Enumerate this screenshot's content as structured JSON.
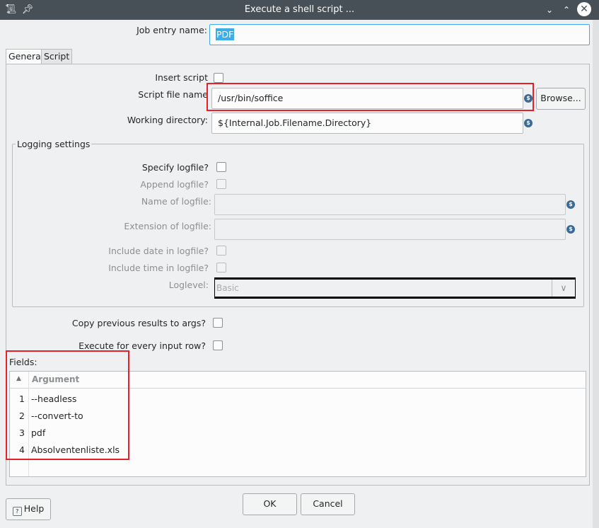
{
  "window": {
    "title": "Execute a shell script ..."
  },
  "job_entry": {
    "label": "Job entry name:",
    "value": "PDF"
  },
  "tabs": [
    {
      "label": "General",
      "active": true
    },
    {
      "label": "Script",
      "active": false
    }
  ],
  "general": {
    "insert_script_label": "Insert script",
    "script_file_label": "Script file name",
    "script_file_value": "/usr/bin/soffice",
    "browse_label": "Browse...",
    "working_dir_label": "Working directory:",
    "working_dir_value": "${Internal.Job.Filename.Directory}"
  },
  "logging": {
    "group_title": "Logging settings",
    "specify_logfile_label": "Specify logfile?",
    "append_logfile_label": "Append logfile?",
    "name_of_logfile_label": "Name of logfile:",
    "extension_label": "Extension of logfile:",
    "include_date_label": "Include date in logfile?",
    "include_time_label": "Include time in logfile?",
    "loglevel_label": "Loglevel:",
    "loglevel_value": "Basic"
  },
  "options": {
    "copy_previous_label": "Copy previous results to args?",
    "execute_every_row_label": "Execute for every input row?"
  },
  "fields": {
    "label": "Fields:",
    "column_header": "Argument",
    "rows": [
      {
        "num": "1",
        "value": "--headless"
      },
      {
        "num": "2",
        "value": "--convert-to"
      },
      {
        "num": "3",
        "value": "pdf"
      },
      {
        "num": "4",
        "value": "Absolventenliste.xls"
      }
    ]
  },
  "buttons": {
    "help": "Help",
    "ok": "OK",
    "cancel": "Cancel"
  },
  "colors": {
    "titlebar": "#475057",
    "highlight_box": "#e8202a",
    "selection": "#3daee9"
  },
  "icons": {
    "app": "script-icon",
    "pin": "pin-icon",
    "variable": "variable-icon",
    "help": "help-icon"
  }
}
